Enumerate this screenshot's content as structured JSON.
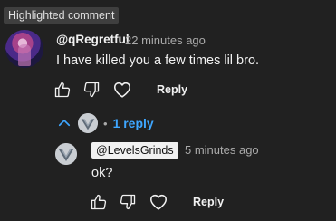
{
  "badge": "Highlighted comment",
  "comment": {
    "author": "@qRegretful",
    "time": "22 minutes ago",
    "text": "I have killed you a few times lil bro.",
    "reply_label": "Reply"
  },
  "replies_toggle": {
    "count_label": "1 reply",
    "separator": "•",
    "accent": "#3ea6ff"
  },
  "reply": {
    "author": "@LevelsGrinds",
    "time": "5 minutes ago",
    "text": "ok?",
    "reply_label": "Reply"
  },
  "icons": [
    "thumbs-up-icon",
    "thumbs-down-icon",
    "heart-icon",
    "chevron-up-icon"
  ]
}
